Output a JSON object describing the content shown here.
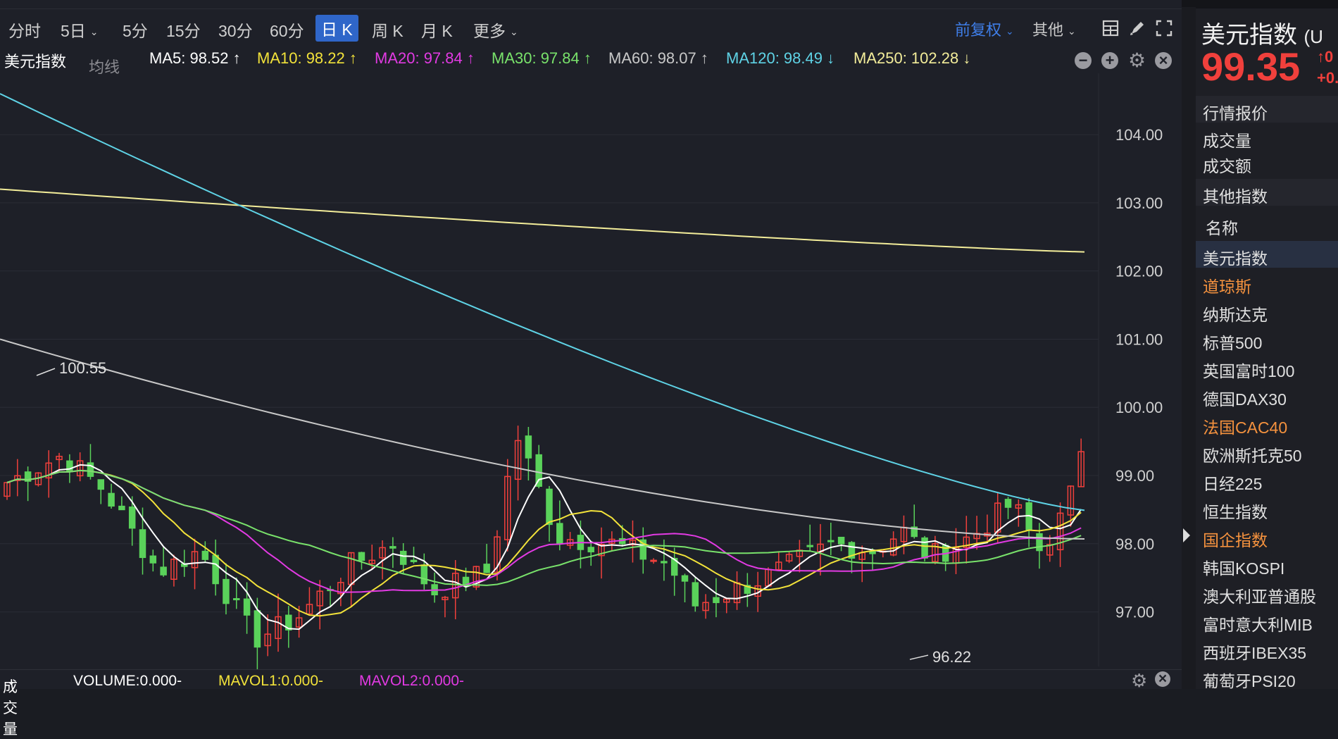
{
  "toolbar": {
    "periods": [
      "分时",
      "5日",
      "5分",
      "15分",
      "30分",
      "60分",
      "日 K",
      "周 K",
      "月 K",
      "更多"
    ],
    "active_period": "日 K",
    "adjust_label": "前复权",
    "other_label": "其他"
  },
  "ma_bar": {
    "symbol": "美元指数",
    "ma_type": "均线",
    "ma5": "MA5: 98.52 ↑",
    "ma10": "MA10: 98.22 ↑",
    "ma20": "MA20: 97.84 ↑",
    "ma30": "MA30: 97.84 ↑",
    "ma60": "MA60: 98.07 ↑",
    "ma120": "MA120: 98.49 ↓",
    "ma250": "MA250: 102.28 ↓"
  },
  "bottom": {
    "volume_label": "成交量",
    "volume": "VOLUME:0.000-",
    "mavol1": "MAVOL1:0.000-",
    "mavol2": "MAVOL2:0.000-"
  },
  "colors": {
    "up": "#f0403c",
    "down": "#5ad25a",
    "ma5": "#ffffff",
    "ma10": "#f2e23a",
    "ma20": "#e23ae3",
    "ma30": "#79e26b",
    "ma60": "#c8c8c8",
    "ma120": "#5fd3e6",
    "ma250": "#f3ed9a"
  },
  "chart_data": {
    "type": "candlestick",
    "title": "美元指数",
    "y_ticks": [
      "104.00",
      "103.00",
      "102.00",
      "101.00",
      "100.00",
      "99.00",
      "98.00",
      "97.00"
    ],
    "ylim": [
      96.2,
      104.9
    ],
    "annotations": [
      {
        "label": "100.55",
        "value": 100.55,
        "kind": "high"
      },
      {
        "label": "96.22",
        "value": 96.22,
        "kind": "low"
      }
    ],
    "ma_series": [
      {
        "name": "MA250",
        "color_key": "ma250",
        "start": 103.2,
        "end": 102.28
      },
      {
        "name": "MA120",
        "color_key": "ma120",
        "start": 104.6,
        "end": 98.49
      },
      {
        "name": "MA60",
        "color_key": "ma60",
        "start": 101.0,
        "end": 98.07
      }
    ],
    "last_close": 99.35
  },
  "sidebar": {
    "name": "美元指数",
    "name_suffix": "(U",
    "price": "99.35",
    "change_arrow": "↑0",
    "change_pct": "+0.",
    "quote_section": "行情报价",
    "volume_label": "成交量",
    "amount_label": "成交额",
    "other_section": "其他指数",
    "col_header": "名称",
    "indices": [
      {
        "name": "美元指数",
        "selected": true,
        "hl": false
      },
      {
        "name": "道琼斯",
        "selected": false,
        "hl": true
      },
      {
        "name": "纳斯达克",
        "selected": false,
        "hl": false
      },
      {
        "name": "标普500",
        "selected": false,
        "hl": false
      },
      {
        "name": "英国富时100",
        "selected": false,
        "hl": false
      },
      {
        "name": "德国DAX30",
        "selected": false,
        "hl": false
      },
      {
        "name": "法国CAC40",
        "selected": false,
        "hl": true
      },
      {
        "name": "欧洲斯托克50",
        "selected": false,
        "hl": false
      },
      {
        "name": "日经225",
        "selected": false,
        "hl": false
      },
      {
        "name": "恒生指数",
        "selected": false,
        "hl": false
      },
      {
        "name": "国企指数",
        "selected": false,
        "hl": true
      },
      {
        "name": "韩国KOSPI",
        "selected": false,
        "hl": false
      },
      {
        "name": "澳大利亚普通股",
        "selected": false,
        "hl": false
      },
      {
        "name": "富时意大利MIB",
        "selected": false,
        "hl": false
      },
      {
        "name": "西班牙IBEX35",
        "selected": false,
        "hl": false
      },
      {
        "name": "葡萄牙PSI20",
        "selected": false,
        "hl": false
      }
    ]
  }
}
